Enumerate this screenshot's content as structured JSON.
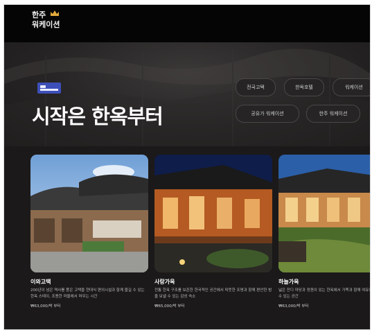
{
  "header": {
    "logo_line1": "한주",
    "logo_line2": "워케이션",
    "logo_icon": "crown-icon"
  },
  "hero": {
    "title": "시작은 한옥부터",
    "badge_icon": "bed-icon",
    "chips": [
      "전국고택",
      "한옥호텔",
      "워케이션",
      "공유가 워케이션",
      "한주 워케이션"
    ]
  },
  "cards": [
    {
      "name": "이와고택",
      "desc": "200년이 넘은 역사를 품은 고택을 현대식 편의시설과 함께 즐길 수 있는 한옥 스테이, 조용한 마을에서 머무는 시간",
      "price": "₩63,000/박 부터"
    },
    {
      "name": "사랑가옥",
      "desc": "전통 한옥 구조를 보존한 한국적인 공간에서 따뜻한 조명과 함께 편안한 밤을 보낼 수 있는 감성 숙소",
      "price": "₩65,000/박 부터"
    },
    {
      "name": "하늘가옥",
      "desc": "넓은 잔디 마당과 정원이 있는 한옥에서 가족과 함께 여유로운 휴식을 즐길 수 있는 공간",
      "price": "₩63,000/박 부터"
    }
  ],
  "colors": {
    "background": "#1b1919",
    "header": "#050505",
    "chip_bg": "#262424",
    "accent_badge": "#3d4fb8"
  }
}
